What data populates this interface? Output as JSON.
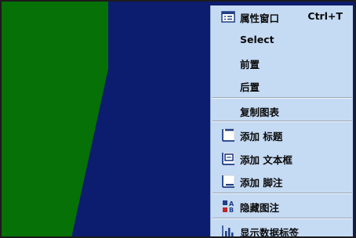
{
  "colors": {
    "series_green": "#067106",
    "series_blue": "#0c1c6e",
    "menu_bg": "#c5daf3",
    "menu_icon_blue": "#1f3f86",
    "menu_icon_red": "#c0252b"
  },
  "context_menu": {
    "items": [
      {
        "label": "属性窗口",
        "shortcut": "Ctrl+T",
        "icon": "properties-window-icon"
      },
      {
        "label": "Select",
        "shortcut": "",
        "icon": ""
      },
      {
        "label": "前置",
        "shortcut": "",
        "icon": ""
      },
      {
        "label": "后置",
        "shortcut": "",
        "icon": ""
      },
      {
        "label": "复制图表",
        "shortcut": "",
        "icon": ""
      },
      {
        "label": "添加 标题",
        "shortcut": "",
        "icon": "add-title-icon"
      },
      {
        "label": "添加 文本框",
        "shortcut": "",
        "icon": "add-textbox-icon"
      },
      {
        "label": "添加 脚注",
        "shortcut": "",
        "icon": "add-footnote-icon"
      },
      {
        "label": "隐藏图注",
        "shortcut": "",
        "icon": "hide-legend-icon"
      },
      {
        "label": "显示数据标签",
        "shortcut": "",
        "icon": "show-data-labels-icon"
      }
    ]
  }
}
